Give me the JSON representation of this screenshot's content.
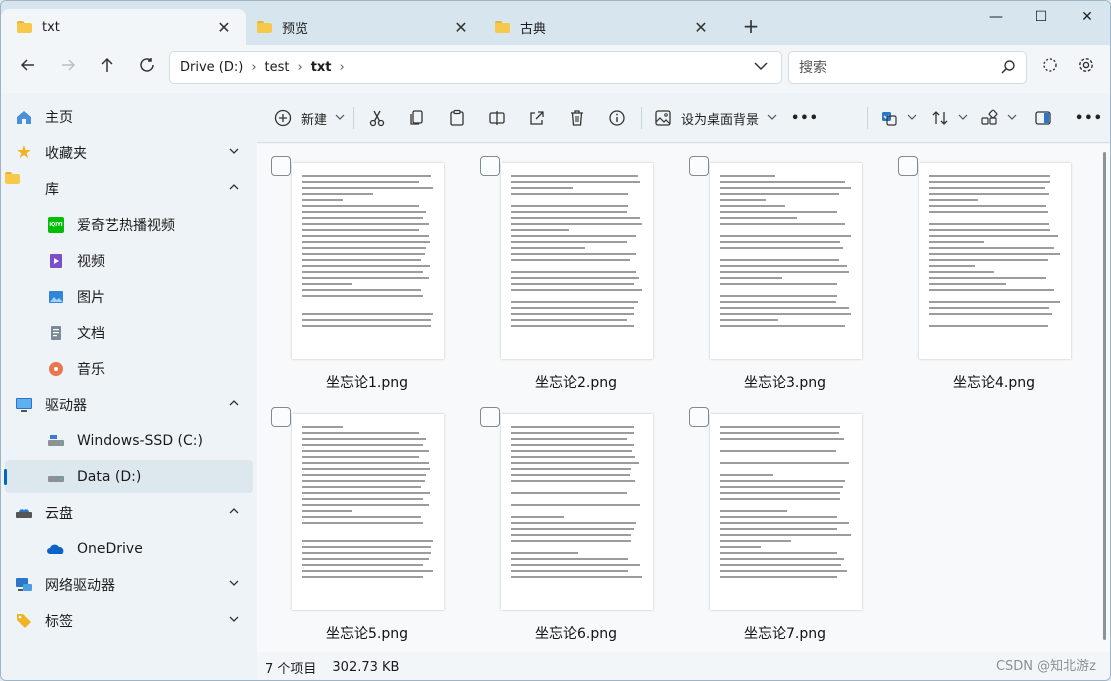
{
  "window": {
    "tabs": [
      {
        "label": "txt",
        "active": true
      },
      {
        "label": "预览",
        "active": false
      },
      {
        "label": "古典",
        "active": false
      }
    ],
    "controls": {
      "minimize": "—",
      "maximize": "☐",
      "close": "✕"
    }
  },
  "address": {
    "crumbs": [
      "Drive (D:)",
      "test",
      "txt"
    ],
    "separator": "›"
  },
  "search": {
    "placeholder": "搜索"
  },
  "sidebar": {
    "items": [
      {
        "label": "主页",
        "icon": "home-icon",
        "chevron": ""
      },
      {
        "label": "收藏夹",
        "icon": "star-icon",
        "chevron": "⌄"
      },
      {
        "label": "库",
        "icon": "folder-icon",
        "chevron": "⌃"
      },
      {
        "label": "爱奇艺热播视频",
        "icon": "iqiyi-icon",
        "chevron": "",
        "badge": "iQIYI"
      },
      {
        "label": "视频",
        "icon": "video-icon",
        "chevron": ""
      },
      {
        "label": "图片",
        "icon": "pictures-icon",
        "chevron": ""
      },
      {
        "label": "文档",
        "icon": "documents-icon",
        "chevron": ""
      },
      {
        "label": "音乐",
        "icon": "music-icon",
        "chevron": ""
      },
      {
        "label": "驱动器",
        "icon": "monitor-icon",
        "chevron": "⌃"
      },
      {
        "label": "Windows-SSD (C:)",
        "icon": "drive-icon",
        "chevron": ""
      },
      {
        "label": "Data (D:)",
        "icon": "drive-icon",
        "chevron": ""
      },
      {
        "label": "云盘",
        "icon": "cloud-drive-icon",
        "chevron": "⌃"
      },
      {
        "label": "OneDrive",
        "icon": "onedrive-icon",
        "chevron": ""
      },
      {
        "label": "网络驱动器",
        "icon": "network-icon",
        "chevron": "⌄"
      },
      {
        "label": "标签",
        "icon": "tag-icon",
        "chevron": "⌄"
      }
    ]
  },
  "toolbar": {
    "new_label": "新建",
    "wallpaper_label": "设为桌面背景",
    "more": "•••"
  },
  "files": [
    {
      "name": "坐忘论1.png"
    },
    {
      "name": "坐忘论2.png"
    },
    {
      "name": "坐忘论3.png"
    },
    {
      "name": "坐忘论4.png"
    },
    {
      "name": "坐忘论5.png"
    },
    {
      "name": "坐忘论6.png"
    },
    {
      "name": "坐忘论7.png"
    }
  ],
  "status": {
    "count": "7 个项目",
    "size": "302.73 KB"
  },
  "watermark": "CSDN @知北游z",
  "colors": {
    "accent": "#0067c0",
    "folder": "#f6c94a"
  }
}
